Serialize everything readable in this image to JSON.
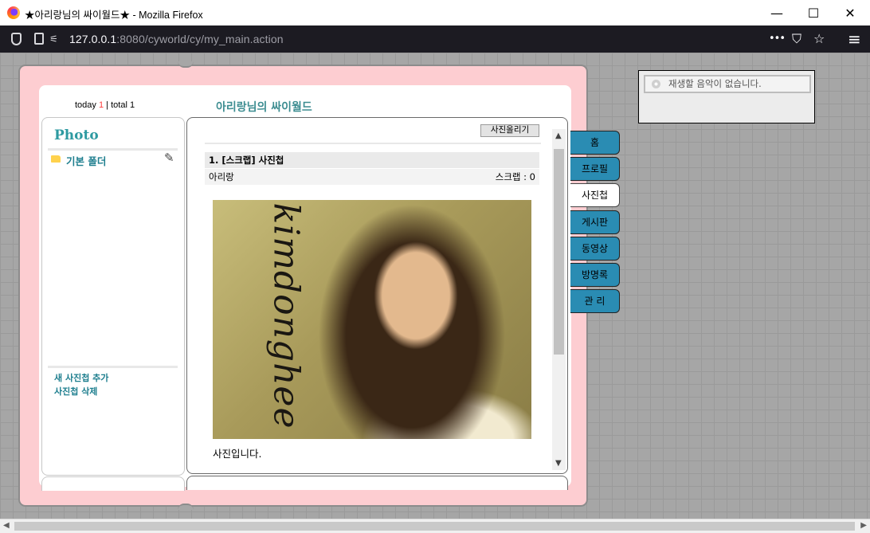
{
  "window": {
    "title": "★아리랑님의 싸이월드★ - Mozilla Firefox",
    "minimize": "—",
    "maximize": "☐",
    "close": "✕"
  },
  "navbar": {
    "url_host": "127.0.0.1",
    "url_rest": ":8080/cyworld/cy/my_main.action",
    "more": "•••",
    "pocket": "⛉",
    "bookmark": "☆",
    "menu": "≡"
  },
  "home": {
    "today_label": "today",
    "today_count": "1",
    "divider": "|",
    "total_label": "total",
    "total_count": "1",
    "site_title": "아리랑님의 싸이월드"
  },
  "left_panel": {
    "heading": "Photo",
    "folder": "기본 폴더",
    "add_album": "새 사진첩 추가",
    "delete_album": "사진첩 삭제"
  },
  "post": {
    "upload_button": "사진올리기",
    "title": "1. [스크랩] 사진첩",
    "author": "아리랑",
    "scrap": "스크랩 : 0",
    "photo_signature": "kimdonghee",
    "caption": "사진입니다."
  },
  "tabs": [
    {
      "label": "홈",
      "active": false
    },
    {
      "label": "프로필",
      "active": false
    },
    {
      "label": "사진첩",
      "active": true
    },
    {
      "label": "게시판",
      "active": false
    },
    {
      "label": "동영상",
      "active": false
    },
    {
      "label": "방명록",
      "active": false
    },
    {
      "label": "관 리",
      "active": false
    }
  ],
  "music": {
    "status": "재생할 음악이 없습니다."
  },
  "colors": {
    "frame": "#fdcdd1",
    "tab": "#2a8cb3",
    "accent": "#2d9aa1",
    "today_count": "#ff3b3b"
  }
}
